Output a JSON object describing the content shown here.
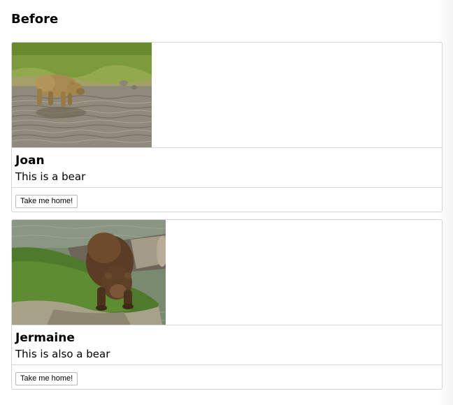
{
  "heading": "Before",
  "cards": [
    {
      "name": "Joan",
      "description": "This is a bear",
      "button_label": "Take me home!",
      "image": "bear-wading-in-stream"
    },
    {
      "name": "Jermaine",
      "description": "This is also a bear",
      "button_label": "Take me home!",
      "image": "bear-drinking-at-river"
    }
  ]
}
